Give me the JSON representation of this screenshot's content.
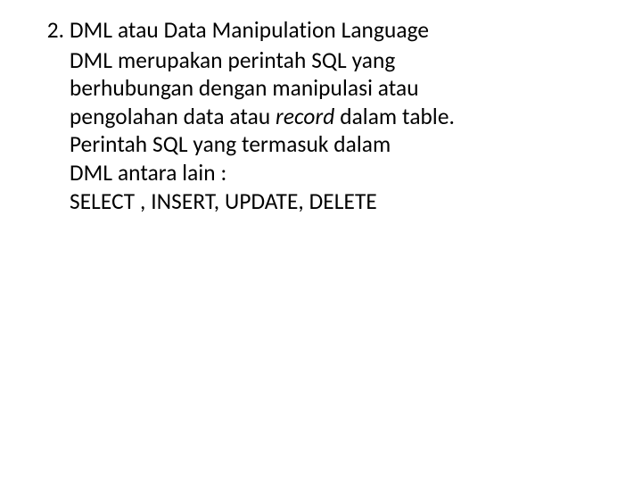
{
  "list": {
    "number": "2.",
    "heading": "DML atau Data Manipulation Language",
    "body": {
      "line1_a": "DML  merupakan  perintah  SQL  yang",
      "line2": "berhubungan  dengan  manipulasi  atau",
      "line3_a": "pengolahan data atau ",
      "line3_italic": "record",
      "line3_b": " dalam table.",
      "line4": "Perintah SQL yang termasuk dalam",
      "line5": "DML antara lain :",
      "line6": "SELECT , INSERT, UPDATE, DELETE"
    }
  }
}
